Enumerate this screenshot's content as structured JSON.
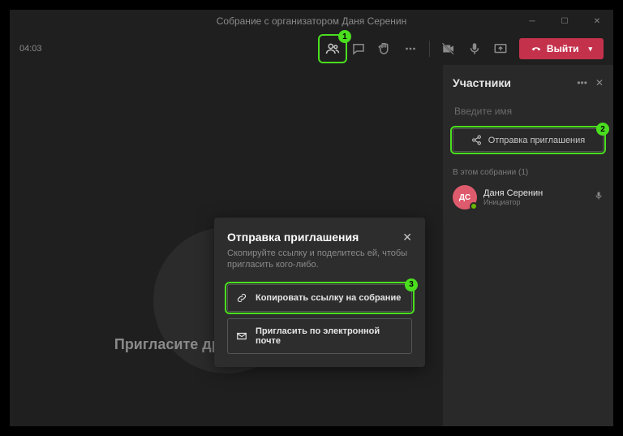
{
  "window": {
    "title": "Собрание с организатором Даня Серенин"
  },
  "toolbar": {
    "timer": "04:03",
    "leave_label": "Выйти"
  },
  "main": {
    "invite_others": "Пригласите других участников"
  },
  "side": {
    "title": "Участники",
    "search_placeholder": "Введите имя",
    "share_invite": "Отправка приглашения",
    "in_meeting_label": "В этом собрании (1)",
    "participant": {
      "initials": "ДС",
      "name": "Даня Серенин",
      "role": "Инициатор"
    }
  },
  "dialog": {
    "title": "Отправка приглашения",
    "subtitle": "Скопируйте ссылку и поделитесь ей, чтобы пригласить кого-либо.",
    "copy_link": "Копировать ссылку на собрание",
    "email_invite": "Пригласить по электронной почте"
  },
  "badges": {
    "b1": "1",
    "b2": "2",
    "b3": "3"
  }
}
